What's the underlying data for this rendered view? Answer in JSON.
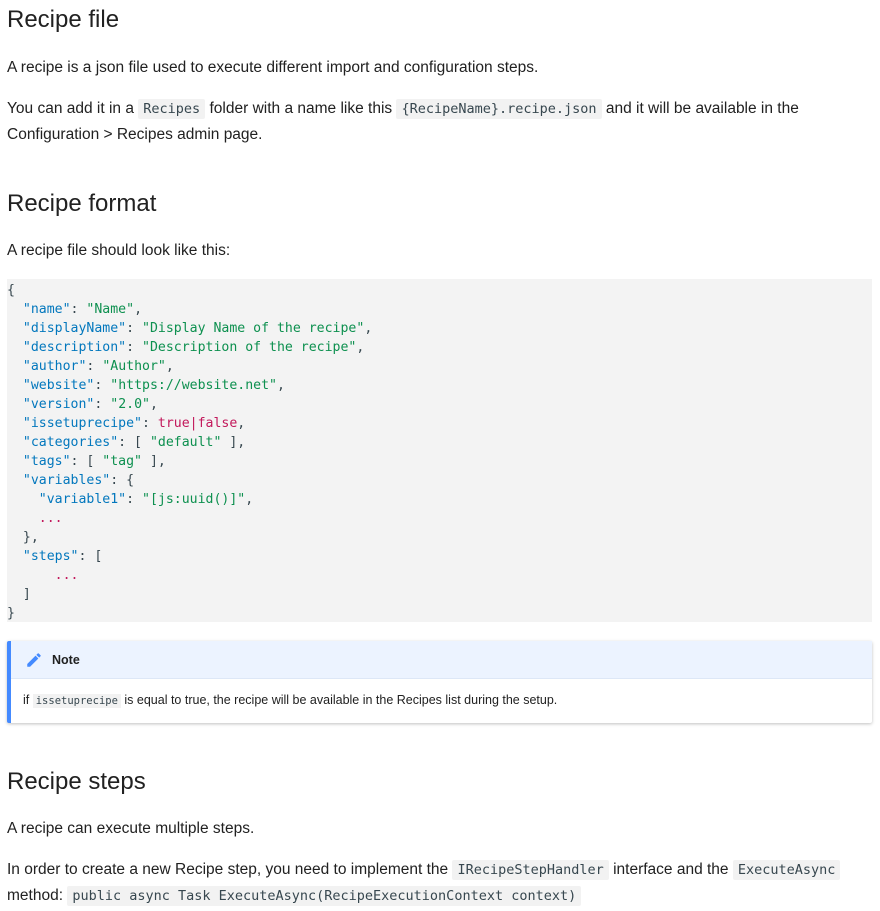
{
  "sections": {
    "recipe_file": {
      "title": "Recipe file",
      "p1": "A recipe is a json file used to execute different import and configuration steps.",
      "p2_a": "You can add it in a ",
      "p2_code1": "Recipes",
      "p2_b": " folder with a name like this ",
      "p2_code2": "{RecipeName}.recipe.json",
      "p2_c": " and it will be available in the Configuration > Recipes admin page."
    },
    "recipe_format": {
      "title": "Recipe format",
      "p1": "A recipe file should look like this:"
    },
    "note": {
      "title": "Note",
      "text_a": "if ",
      "code": "issetuprecipe",
      "text_b": " is equal to true, the recipe will be available in the Recipes list during the setup."
    },
    "recipe_steps": {
      "title": "Recipe steps",
      "p1": "A recipe can execute multiple steps.",
      "p2_a": "In order to create a new Recipe step, you need to implement the ",
      "p2_code1": "IRecipeStepHandler",
      "p2_b": " interface and the ",
      "p2_code2": "ExecuteAsync",
      "p2_c": " method: ",
      "p2_code3": "public async Task ExecuteAsync(RecipeExecutionContext context)"
    }
  },
  "code": {
    "open_brace": "{",
    "name_key": "\"name\"",
    "name_val": "\"Name\"",
    "display_key": "\"displayName\"",
    "display_val": "\"Display Name of the recipe\"",
    "desc_key": "\"description\"",
    "desc_val": "\"Description of the recipe\"",
    "author_key": "\"author\"",
    "author_val": "\"Author\"",
    "website_key": "\"website\"",
    "website_val": "\"https://website.net\"",
    "version_key": "\"version\"",
    "version_val": "\"2.0\"",
    "issetup_key": "\"issetuprecipe\"",
    "issetup_val": "true|false",
    "categories_key": "\"categories\"",
    "categories_val": "\"default\"",
    "tags_key": "\"tags\"",
    "tags_val": "\"tag\"",
    "variables_key": "\"variables\"",
    "variable1_key": "\"variable1\"",
    "variable1_val": "\"[js:uuid()]\"",
    "ellipsis": "...",
    "steps_key": "\"steps\"",
    "close_brace": "}"
  },
  "colors": {
    "key": "#0277bd",
    "string": "#0d904f",
    "boolean": "#c2185b",
    "note_accent": "#448aff",
    "note_header_bg": "#ecf3ff",
    "code_bg": "#f3f3f3"
  },
  "icons": {
    "note_icon": "pencil-icon"
  }
}
